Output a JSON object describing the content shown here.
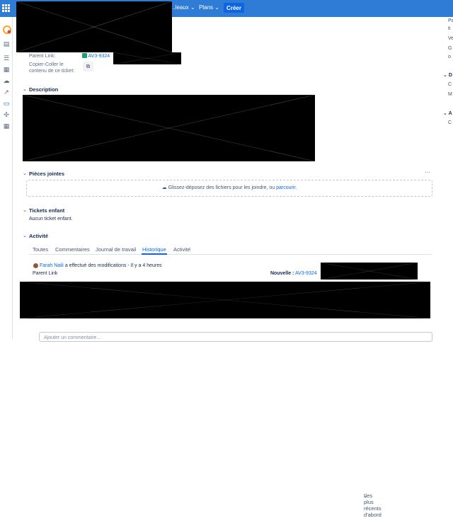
{
  "topbar": {
    "nav": [
      "...leaux",
      "Plans"
    ],
    "create_label": "Créer"
  },
  "sidebar_icons": [
    "logo-icon",
    "chat-icon",
    "list-icon",
    "board-icon",
    "cloud-icon",
    "chart-icon",
    "ticket-icon",
    "puzzle-icon",
    "table-icon"
  ],
  "fields": {
    "parent_link_label": "Parent Link:",
    "parent_link_value": "AV3-9324",
    "copy_label_1": "Copier-Coller le",
    "copy_label_2": "contenu de ce ticket:"
  },
  "sections": {
    "description": "Description",
    "attachments": "Pièces jointes",
    "attachments_more": "···",
    "drop_text": "Glissez-déposez des fichiers pour les joindre, ou",
    "drop_link": "parcourir.",
    "children": "Tickets enfant",
    "children_empty": "Aucun ticket enfant.",
    "activity": "Activité"
  },
  "activity": {
    "tabs": [
      "Toutes",
      "Commentaires",
      "Journal de travail",
      "Historique",
      "Activité"
    ],
    "active_tab": "Historique",
    "sort": "Les plus récents d'abord",
    "user": "Farah Naili",
    "change_text": "a effectué des modifications - Il y a 4 heures",
    "field": "Parent Link",
    "new_label": "Nouvelle :",
    "new_value": "AV3-9324"
  },
  "comment_placeholder": "Ajouter un commentaire...",
  "right_panel": {
    "frag1": "Pa",
    "frag2": "ti",
    "frag3": "Ve",
    "frag4": "G",
    "frag5": "o",
    "frag6": "D",
    "frag7": "C",
    "frag8": "M",
    "frag9": "A",
    "frag10": "C"
  }
}
